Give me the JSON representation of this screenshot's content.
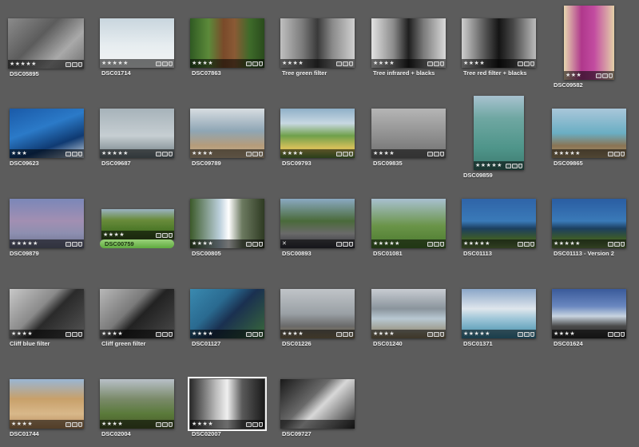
{
  "photos": [
    {
      "name": "DSC05895",
      "stars": "★★★★★",
      "bg": "linear-gradient(135deg,#8b8b8b,#5c5c5c 40%,#a9a9a9 70%,#6f6f6f)"
    },
    {
      "name": "DSC01714",
      "stars": "★★★★★",
      "bg": "linear-gradient(180deg,#c9d6de,#e7edf0 55%,#f2f4f5)"
    },
    {
      "name": "DSC07863",
      "stars": "★★★★",
      "bg": "linear-gradient(90deg,#2f5a22,#5c8a3a 25%,#7a4a2a 45%,#8a5a35 60%,#3e6b2a 80%,#2a4b1c)"
    },
    {
      "name": "Tree green filter",
      "stars": "★★★★",
      "bg": "linear-gradient(90deg,#bfbfbf,#7a7a7a 30%,#3a3a3a 50%,#8a8a8a 70%,#d0d0d0)"
    },
    {
      "name": "Tree infrared + blacks",
      "stars": "★★★★",
      "bg": "linear-gradient(90deg,#e2e2e2,#8a8a8a 30%,#1e1e1e 50%,#7a7a7a 70%,#dadada)"
    },
    {
      "name": "Tree red filter + blacks",
      "stars": "★★★★",
      "bg": "linear-gradient(90deg,#cfcfcf,#5a5a5a 30%,#141414 50%,#4a4a4a 70%,#bcbcbc)"
    },
    {
      "name": "DSC09582",
      "stars": "★★★",
      "bg": "linear-gradient(90deg,#e8d8b0,#b0388c 35%,#c24ba0 60%,#e4d0a8)"
    },
    {
      "name": "DSC09623",
      "stars": "★★★",
      "bg": "linear-gradient(160deg,#1a5aa8,#2b7ac8 40%,#0f3a72 70%,#cfd9e2)"
    },
    {
      "name": "DSC09687",
      "stars": "★★★★★",
      "bg": "linear-gradient(180deg,#a7b3ba,#c6ced2 55%,#6c7a80)"
    },
    {
      "name": "DSC09789",
      "stars": "★★★★",
      "bg": "linear-gradient(180deg,#d7dde1,#8fa6b5 45%,#b59c7a 75%,#cbb595)"
    },
    {
      "name": "DSC09793",
      "stars": "★★★★",
      "bg": "linear-gradient(180deg,#8fb0c8,#c8d8e2 30%,#6fa04a 55%,#d8c05a 80%,#5b8a3c)"
    },
    {
      "name": "DSC09835",
      "stars": "★★★★",
      "bg": "linear-gradient(180deg,#b5b5b5,#8c8c8c 60%,#6f6f6f)"
    },
    {
      "name": "DSC09859",
      "stars": "★★★★★",
      "bg": "linear-gradient(180deg,#a8c2d0,#6fa7a2 30%,#4f958a 70%,#3d7b70)"
    },
    {
      "name": "DSC09865",
      "stars": "★★★★★",
      "bg": "linear-gradient(180deg,#a9c7da,#6aaec3 50%,#8a7454 75%,#b09a72)"
    },
    {
      "name": "DSC09879",
      "stars": "★★★★★",
      "bg": "linear-gradient(180deg,#7b87b8,#a28fb2 45%,#8d8fb0 70%,#6b6f8a)"
    },
    {
      "name": "DSC00759",
      "stars": "★★★★",
      "bg": "linear-gradient(180deg,#9ab2c2,#6a8c3c 35%,#4f7a2a 65%,#3d5a22)"
    },
    {
      "name": "DSC00805",
      "stars": "★★★★",
      "bg": "linear-gradient(90deg,#3c5a2a,#bcd0dc 40%,#ffffff 52%,#6c7a60 70%,#2e3a22)"
    },
    {
      "name": "DSC00893",
      "stars": "✕",
      "bg": "linear-gradient(180deg,#8aa9c2,#4a6a3a 45%,#6a6a6a 70%,#2f2f3a)"
    },
    {
      "name": "DSC01081",
      "stars": "★★★★★",
      "bg": "linear-gradient(180deg,#a8c0d0,#6a9448 55%,#4a7a2e)"
    },
    {
      "name": "DSC01113",
      "stars": "★★★★★",
      "bg": "linear-gradient(180deg,#2f64a8,#3a7ab8 45%,#1c3f60 60%,#3c5a2a 80%,#6c8a4a)"
    },
    {
      "name": "DSC01113 - Version 2",
      "stars": "★★★★★",
      "bg": "linear-gradient(180deg,#2a5da2,#3a7ab8 45%,#1c3f60 60%,#3c5a2a 80%,#6c8a4a)"
    },
    {
      "name": "Cliff blue filter",
      "stars": "★★★★",
      "bg": "linear-gradient(135deg,#c8c8c8,#8a8a8a 40%,#2a2a2a 55%,#555555)"
    },
    {
      "name": "Cliff green filter",
      "stars": "★★★★",
      "bg": "linear-gradient(135deg,#b8b8b8,#7a7a7a 40%,#222222 55%,#4a4a4a)"
    },
    {
      "name": "DSC01127",
      "stars": "★★★★",
      "bg": "linear-gradient(135deg,#3a8ab0,#2a6a90 35%,#1a3050 55%,#3a6a3a)"
    },
    {
      "name": "DSC01226",
      "stars": "★★★★",
      "bg": "linear-gradient(180deg,#c0c4c8,#9aa0a5 50%,#6a6a6a 75%,#8a7a5a)"
    },
    {
      "name": "DSC01240",
      "stars": "★★★★",
      "bg": "linear-gradient(180deg,#c8ccd2,#8a949c 40%,#b8c8d2 60%,#8a7a5a)"
    },
    {
      "name": "DSC01371",
      "stars": "★★★★★",
      "bg": "linear-gradient(180deg,#8aa6c8,#dfe6ec 40%,#9fc6d8 60%,#3a8aa8)"
    },
    {
      "name": "DSC01624",
      "stars": "★★★★",
      "bg": "linear-gradient(180deg,#3a5a9a,#6a88c0 35%,#c8d4e0 55%,#4a4a4a 75%,#2a2a2a)"
    },
    {
      "name": "DSC01744",
      "stars": "★★★★",
      "bg": "linear-gradient(180deg,#9ab6d4,#c8a06a 40%,#d8b88a 70%,#b88a5a)"
    },
    {
      "name": "DSC02004",
      "stars": "★★★★",
      "bg": "linear-gradient(180deg,#b8c0c8,#7a8a6a 40%,#5a7a3a 70%,#4a5a2a)"
    },
    {
      "name": "DSC02007",
      "stars": "★★★★",
      "bg": "linear-gradient(90deg,#2a2a2a,#bcbcbc 35%,#f0f0f0 50%,#5a5a5a 70%,#1a1a1a)"
    },
    {
      "name": "DSC09727",
      "stars": "",
      "bg": "linear-gradient(135deg,#1a1a1a,#6a6a6a 40%,#d8d8d8 55%,#2a2a2a)"
    }
  ]
}
